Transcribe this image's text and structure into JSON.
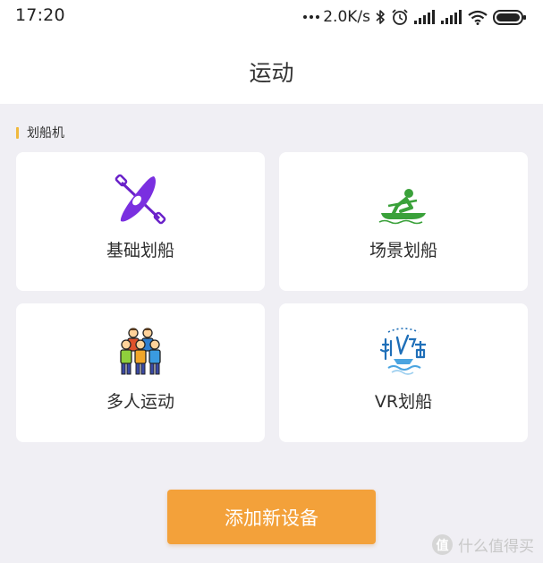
{
  "status_bar": {
    "time": "17:20",
    "net_speed": "2.0K/s"
  },
  "header": {
    "title": "运动"
  },
  "section": {
    "title": "划船机",
    "accent_color": "#f0b93e"
  },
  "cards": [
    {
      "label": "基础划船",
      "icon": "kayak-icon"
    },
    {
      "label": "场景划船",
      "icon": "rower-icon"
    },
    {
      "label": "多人运动",
      "icon": "group-people-icon"
    },
    {
      "label": "VR划船",
      "icon": "vr-boat-icon"
    }
  ],
  "add_button": {
    "label": "添加新设备",
    "color": "#f3a13a"
  },
  "watermark": {
    "logo_text": "值",
    "text": "什么值得买"
  }
}
